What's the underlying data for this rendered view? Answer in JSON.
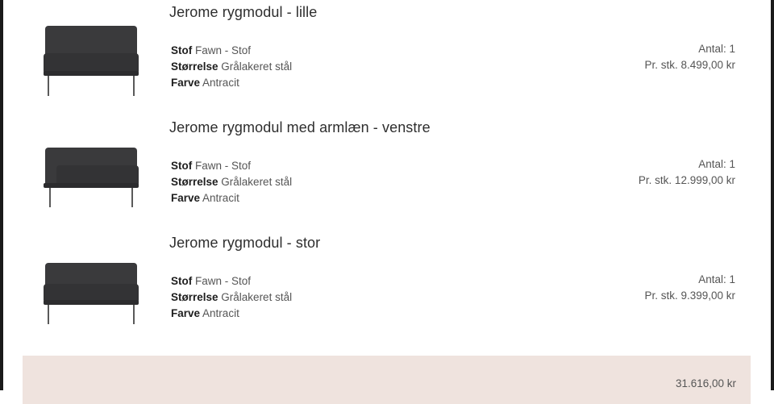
{
  "cart": {
    "items": [
      {
        "title": "Jerome rygmodul - lille",
        "image": "sofa-module-icon",
        "fabric_key": "Stof",
        "fabric_value": "Fawn - Stof",
        "size_key": "Størrelse",
        "size_value": "Grålakeret stål",
        "color_key": "Farve",
        "color_value": "Antracit",
        "quantity": "Antal: 1",
        "unit_price": "Pr. stk. 8.499,00 kr"
      },
      {
        "title": "Jerome rygmodul med armlæn - venstre",
        "image": "sofa-module-armrest-icon",
        "fabric_key": "Stof",
        "fabric_value": "Fawn - Stof",
        "size_key": "Størrelse",
        "size_value": "Grålakeret stål",
        "color_key": "Farve",
        "color_value": "Antracit",
        "quantity": "Antal: 1",
        "unit_price": "Pr. stk. 12.999,00 kr"
      },
      {
        "title": "Jerome rygmodul - stor",
        "image": "sofa-module-icon",
        "fabric_key": "Stof",
        "fabric_value": "Fawn - Stof",
        "size_key": "Størrelse",
        "size_value": "Grålakeret stål",
        "color_key": "Farve",
        "color_value": "Antracit",
        "quantity": "Antal: 1",
        "unit_price": "Pr. stk. 9.399,00 kr"
      }
    ],
    "total": "31.616,00 kr"
  },
  "colors": {
    "sofa_fabric": "#3a3a3c",
    "sofa_legs": "#5a5a5a",
    "total_bar_bg": "#efe3de"
  }
}
